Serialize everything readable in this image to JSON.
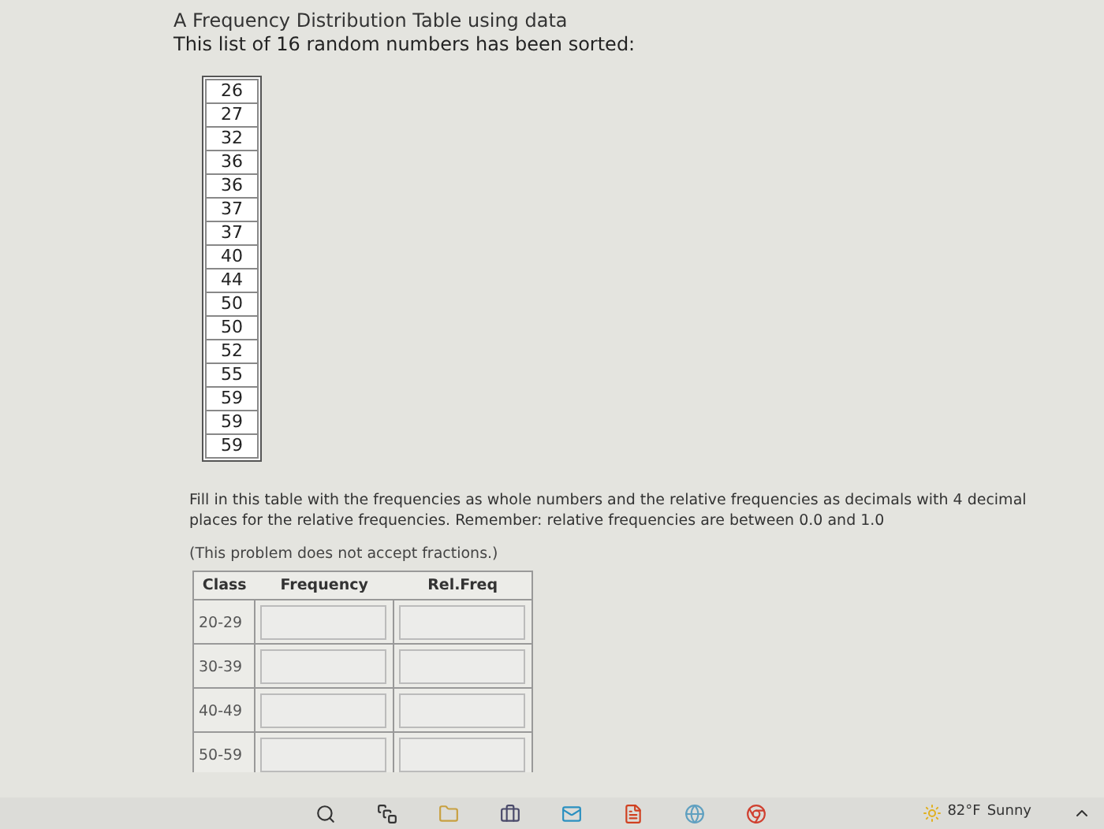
{
  "heading": "A Frequency Distribution Table using data",
  "intro": "This list of 16 random numbers has been sorted:",
  "numbers": [
    "26",
    "27",
    "32",
    "36",
    "36",
    "37",
    "37",
    "40",
    "44",
    "50",
    "50",
    "52",
    "55",
    "59",
    "59",
    "59"
  ],
  "instructions": "Fill in this table with the frequencies as whole numbers and the relative frequencies as decimals with 4 decimal places for the relative frequencies. Remember: relative frequencies are between 0.0 and 1.0",
  "note": "(This problem does not accept fractions.)",
  "table": {
    "columns": [
      "Class",
      "Frequency",
      "Rel.Freq"
    ],
    "rows": [
      {
        "class": "20-29"
      },
      {
        "class": "30-39"
      },
      {
        "class": "40-49"
      },
      {
        "class": "50-59"
      }
    ]
  },
  "taskbar": {
    "weather": "82°F",
    "condition": "Sunny"
  }
}
